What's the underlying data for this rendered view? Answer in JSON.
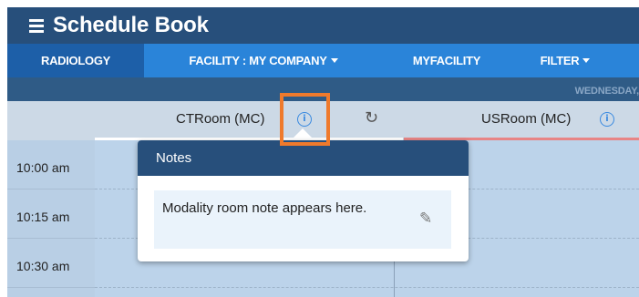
{
  "app": {
    "title": "Schedule Book"
  },
  "nav": {
    "items": [
      {
        "label": "RADIOLOGY",
        "active": true
      },
      {
        "label": "FACILITY : MY COMPANY",
        "dropdown": true
      },
      {
        "label": "MYFACILITY"
      },
      {
        "label": "FILTER",
        "dropdown": true
      }
    ]
  },
  "day": {
    "label": "WEDNESDAY,"
  },
  "rooms": [
    {
      "name": "CTRoom (MC)"
    },
    {
      "name": "USRoom (MC)"
    }
  ],
  "times": [
    "10:00 am",
    "10:15 am",
    "10:30 am"
  ],
  "notes": {
    "title": "Notes",
    "text": "Modality room note appears here."
  },
  "colors": {
    "header": "#274f7b",
    "nav": "#2a84d9",
    "nav_active": "#1d5fa8",
    "highlight": "#ef7a2c",
    "info": "#3a8ae0"
  },
  "icons": [
    "menu-icon",
    "info-icon",
    "refresh-icon",
    "pencil-icon",
    "chevron-down-icon"
  ]
}
